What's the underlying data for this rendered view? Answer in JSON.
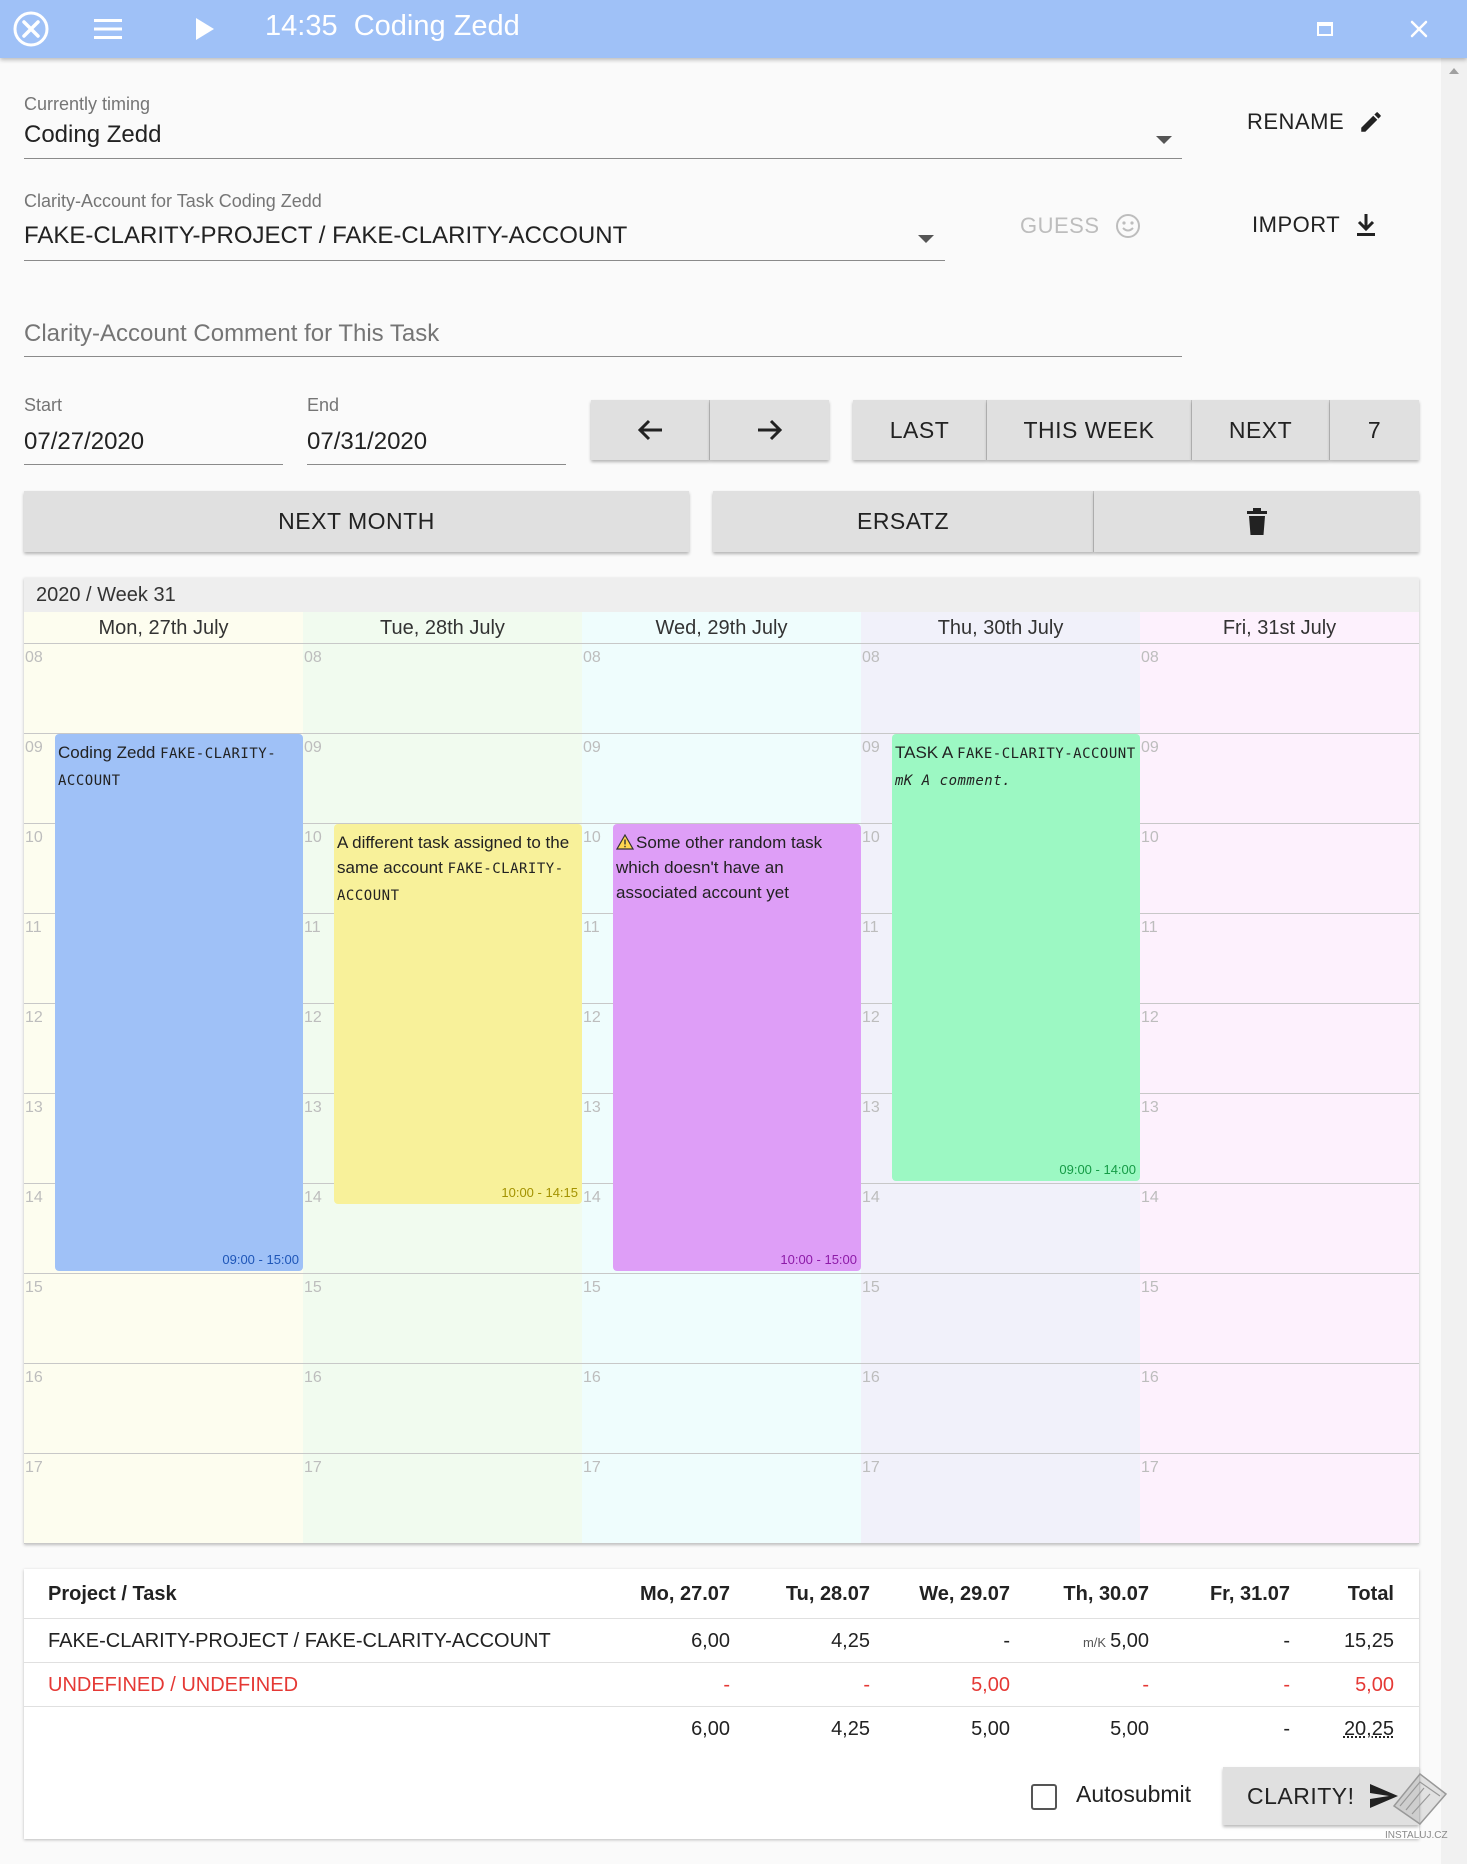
{
  "titlebar": {
    "time": "14:35",
    "task": "Coding Zedd",
    "icons": [
      "close-circle-icon",
      "menu-icon",
      "play-icon",
      "maximize-icon",
      "close-icon"
    ]
  },
  "form": {
    "timing_label": "Currently timing",
    "timing_value": "Coding Zedd",
    "rename_label": "RENAME",
    "account_label": "Clarity-Account for Task Coding Zedd",
    "account_value": "FAKE-CLARITY-PROJECT / FAKE-CLARITY-ACCOUNT",
    "guess_label": "GUESS",
    "import_label": "IMPORT",
    "comment_placeholder": "Clarity-Account Comment for This Task",
    "start_label": "Start",
    "start_value": "07/27/2020",
    "end_label": "End",
    "end_value": "07/31/2020"
  },
  "nav": {
    "last": "LAST",
    "this_week": "THIS WEEK",
    "next": "NEXT",
    "days": "7",
    "next_month": "NEXT MONTH",
    "ersatz": "ERSATZ"
  },
  "calendar": {
    "title": "2020 / Week 31",
    "hours": [
      "08",
      "09",
      "10",
      "11",
      "12",
      "13",
      "14",
      "15",
      "16",
      "17"
    ],
    "days": [
      {
        "name": "Mon, 27th July",
        "color": "#fdfdef"
      },
      {
        "name": "Tue, 28th July",
        "color": "#f1fbef"
      },
      {
        "name": "Wed, 29th July",
        "color": "#effdfd"
      },
      {
        "name": "Thu, 30th July",
        "color": "#f1f1fa"
      },
      {
        "name": "Fri, 31st July",
        "color": "#fdf1fd"
      }
    ],
    "events": [
      {
        "day": 0,
        "start": 9,
        "end": 15,
        "title": "Coding Zedd",
        "account": "FAKE-CLARITY-ACCOUNT",
        "comment": "",
        "time": "09:00 - 15:00",
        "color": "#9fc1f7",
        "time_color": "#1e56b8",
        "warning": false
      },
      {
        "day": 1,
        "start": 10,
        "end": 14.25,
        "title": "A different task assigned to the same account",
        "account": "FAKE-CLARITY-ACCOUNT",
        "comment": "",
        "time": "10:00 - 14:15",
        "color": "#f8f19a",
        "time_color": "#a39200",
        "warning": false
      },
      {
        "day": 2,
        "start": 10,
        "end": 15,
        "title": "Some other random task which doesn't have an associated account yet",
        "account": "",
        "comment": "",
        "time": "10:00 - 15:00",
        "color": "#de9ef7",
        "time_color": "#8d1aa8",
        "warning": true
      },
      {
        "day": 3,
        "start": 9,
        "end": 14,
        "title": "TASK A",
        "account": "FAKE-CLARITY-ACCOUNT",
        "comment": "mK A comment.",
        "time": "09:00 - 14:00",
        "color": "#9cf8c3",
        "time_color": "#159b46",
        "warning": false
      }
    ]
  },
  "table": {
    "headers": [
      "Project / Task",
      "Mo, 27.07",
      "Tu, 28.07",
      "We, 29.07",
      "Th, 30.07",
      "Fr, 31.07",
      "Total"
    ],
    "rows": [
      {
        "name": "FAKE-CLARITY-PROJECT / FAKE-CLARITY-ACCOUNT",
        "values": [
          "6,00",
          "4,25",
          "-",
          "5,00",
          "-",
          "15,25"
        ],
        "note": "m/K",
        "red": false
      },
      {
        "name": "UNDEFINED / UNDEFINED",
        "values": [
          "-",
          "-",
          "5,00",
          "-",
          "-",
          "5,00"
        ],
        "note": "",
        "red": true
      }
    ],
    "totals": [
      "6,00",
      "4,25",
      "5,00",
      "5,00",
      "-",
      "20,25"
    ]
  },
  "footer": {
    "autosubmit_label": "Autosubmit",
    "submit_label": "CLARITY!",
    "watermark": "INSTALUJ.CZ"
  }
}
